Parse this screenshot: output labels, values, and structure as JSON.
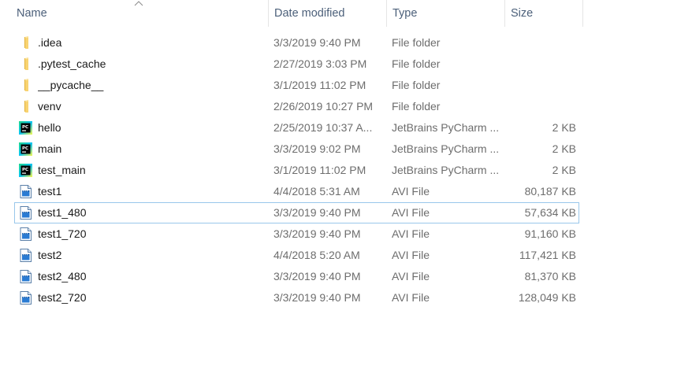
{
  "columns": {
    "name": "Name",
    "date_modified": "Date modified",
    "type": "Type",
    "size": "Size"
  },
  "sort": {
    "column": "name",
    "direction": "ascending"
  },
  "files": [
    {
      "name": ".idea",
      "date": "3/3/2019 9:40 PM",
      "type": "File folder",
      "size": "",
      "icon": "folder-icon"
    },
    {
      "name": ".pytest_cache",
      "date": "2/27/2019 3:03 PM",
      "type": "File folder",
      "size": "",
      "icon": "folder-icon"
    },
    {
      "name": "__pycache__",
      "date": "3/1/2019 11:02 PM",
      "type": "File folder",
      "size": "",
      "icon": "folder-icon"
    },
    {
      "name": "venv",
      "date": "2/26/2019 10:27 PM",
      "type": "File folder",
      "size": "",
      "icon": "folder-icon"
    },
    {
      "name": "hello",
      "date": "2/25/2019 10:37 A...",
      "type": "JetBrains PyCharm ...",
      "size": "2 KB",
      "icon": "pycharm-icon"
    },
    {
      "name": "main",
      "date": "3/3/2019 9:02 PM",
      "type": "JetBrains PyCharm ...",
      "size": "2 KB",
      "icon": "pycharm-icon"
    },
    {
      "name": "test_main",
      "date": "3/1/2019 11:02 PM",
      "type": "JetBrains PyCharm ...",
      "size": "2 KB",
      "icon": "pycharm-icon"
    },
    {
      "name": "test1",
      "date": "4/4/2018 5:31 AM",
      "type": "AVI File",
      "size": "80,187 KB",
      "icon": "video-file-icon"
    },
    {
      "name": "test1_480",
      "date": "3/3/2019 9:40 PM",
      "type": "AVI File",
      "size": "57,634 KB",
      "icon": "video-file-icon",
      "focused": true
    },
    {
      "name": "test1_720",
      "date": "3/3/2019 9:40 PM",
      "type": "AVI File",
      "size": "91,160 KB",
      "icon": "video-file-icon"
    },
    {
      "name": "test2",
      "date": "4/4/2018 5:20 AM",
      "type": "AVI File",
      "size": "117,421 KB",
      "icon": "video-file-icon"
    },
    {
      "name": "test2_480",
      "date": "3/3/2019 9:40 PM",
      "type": "AVI File",
      "size": "81,370 KB",
      "icon": "video-file-icon"
    },
    {
      "name": "test2_720",
      "date": "3/3/2019 9:40 PM",
      "type": "AVI File",
      "size": "128,049 KB",
      "icon": "video-file-icon"
    }
  ],
  "colors": {
    "header_text": "#4c607a",
    "folder": "#f6c94d",
    "focus_border": "#99c7eb",
    "secondary_text": "#6d6d6d"
  }
}
